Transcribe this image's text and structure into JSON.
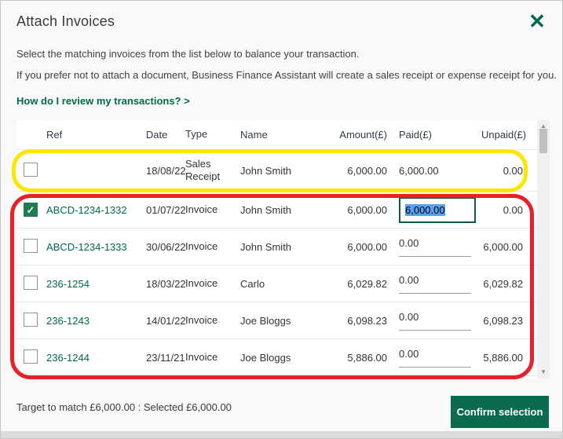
{
  "modal": {
    "title": "Attach Invoices",
    "intro_line1": "Select the matching invoices from the list below to balance your transaction.",
    "intro_line2": "If you prefer not to attach a document, Business Finance Assistant will create a sales receipt or expense receipt for you.",
    "help_link": "How do I review my transactions? >"
  },
  "icons": {
    "close": "✕",
    "sort_desc": "▼",
    "check": "✓",
    "scroll_up": "▲",
    "scroll_down": "▼"
  },
  "table": {
    "columns": [
      "Ref",
      "Date",
      "Type",
      "Name",
      "Amount(£)",
      "Paid(£)",
      "Unpaid(£)"
    ],
    "sorted_by": "Date",
    "rows": [
      {
        "checked": false,
        "ref": "",
        "date": "18/08/22",
        "type": "Sales Receipt",
        "name": "John Smith",
        "amount": "6,000.00",
        "paid": "6,000.00",
        "unpaid": "0.00",
        "paid_state": "plain"
      },
      {
        "checked": true,
        "ref": "ABCD-1234-1332",
        "date": "01/07/22",
        "type": "Invoice",
        "name": "John Smith",
        "amount": "6,000.00",
        "paid": "6,000.00",
        "unpaid": "0.00",
        "paid_state": "active"
      },
      {
        "checked": false,
        "ref": "ABCD-1234-1333",
        "date": "30/06/22",
        "type": "Invoice",
        "name": "John Smith",
        "amount": "6,000.00",
        "paid": "0.00",
        "unpaid": "6,000.00",
        "paid_state": "underline"
      },
      {
        "checked": false,
        "ref": "236-1254",
        "date": "18/03/22",
        "type": "Invoice",
        "name": "Carlo",
        "amount": "6,029.82",
        "paid": "0.00",
        "unpaid": "6,029.82",
        "paid_state": "underline"
      },
      {
        "checked": false,
        "ref": "236-1243",
        "date": "14/01/22",
        "type": "Invoice",
        "name": "Joe Bloggs",
        "amount": "6,098.23",
        "paid": "0.00",
        "unpaid": "6,098.23",
        "paid_state": "underline"
      },
      {
        "checked": false,
        "ref": "236-1244",
        "date": "23/11/21",
        "type": "Invoice",
        "name": "Joe Bloggs",
        "amount": "5,886.00",
        "paid": "0.00",
        "unpaid": "5,886.00",
        "paid_state": "underline"
      }
    ]
  },
  "footer": {
    "summary": "Target to match £6,000.00 : Selected £6,000.00",
    "confirm_label": "Confirm selection"
  },
  "colors": {
    "brand_green": "#006a4d",
    "checkbox_green": "#1d7c52",
    "selection_blue": "#5b9ff2",
    "annotation_yellow": "#ffe600",
    "annotation_red": "#e8202a"
  }
}
